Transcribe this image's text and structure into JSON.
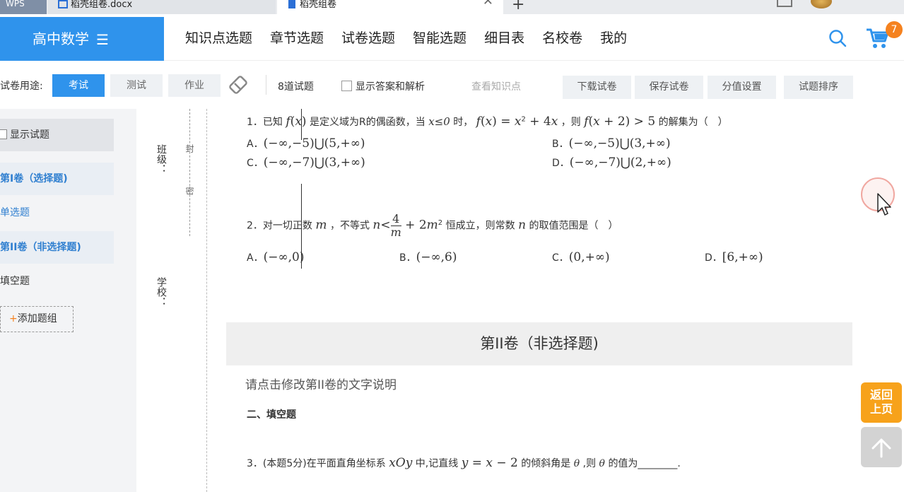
{
  "tabs": {
    "wps": "WPS",
    "docx": "稻壳组卷.docx",
    "active": "稻壳组卷",
    "close": "✕",
    "plus": "+"
  },
  "header": {
    "brand": "高中数学",
    "menu_icon": "☰",
    "nav": [
      "知识点选题",
      "章节选题",
      "试卷选题",
      "智能选题",
      "细目表",
      "名校卷",
      "我的"
    ],
    "cart_count": "7"
  },
  "toolbar": {
    "label": "试卷用途:",
    "purposes": [
      "考试",
      "测试",
      "作业"
    ],
    "question_count": "8道试题",
    "show_answer": "显示答案和解析",
    "view_knowledge": "查看知识点",
    "actions": [
      "下载试卷",
      "保存试卷",
      "分值设置",
      "试题排序"
    ]
  },
  "sidebar": {
    "show_questions": "显示试题",
    "items": [
      "第I卷（选择题)",
      "单选题",
      "第II卷（非选择题)",
      "填空题"
    ],
    "add_group_plus": "+",
    "add_group": "添加题组"
  },
  "binding": {
    "class": "班级：",
    "school": "学校：",
    "seal": "封",
    "secret": "密"
  },
  "questions": {
    "q1": {
      "num": "1．已知",
      "p1": "是定义域为R的偶函数，当",
      "cond": "x≤0",
      "p2": "时，",
      "p3": "，则",
      "p4": "的解集为（　）",
      "A": "A．",
      "A_val": "(−∞,−5)⋃(5,+∞)",
      "B": "B．",
      "B_val": "(−∞,−5)⋃(3,+∞)",
      "C": "C．",
      "C_val": "(−∞,−7)⋃(3,+∞)",
      "D": "D．",
      "D_val": "(−∞,−7)⋃(2,+∞)"
    },
    "q2": {
      "num": "2．对一切正数",
      "p1": "，不等式",
      "p2": "恒成立，则常数",
      "p3": "的取值范围是（　）",
      "A": "A．",
      "A_val": "(−∞,0)",
      "B": "B．",
      "B_val": "(−∞,6)",
      "C": "C．",
      "C_val": "(0,+∞)",
      "D": "D．",
      "D_val": "[6,+∞)"
    },
    "section2_title": "第II卷（非选择题)",
    "section2_desc": "请点击修改第II卷的文字说明",
    "section2_sub": "二、填空题",
    "q3": {
      "num": "3．(本题5分)在平面直角坐标系",
      "p1": "中,记直线",
      "p2": "的倾斜角是",
      "p3": ",则",
      "p4": "的值为________."
    }
  },
  "floating": {
    "back_line1": "返回",
    "back_line2": "上页"
  },
  "colors": {
    "brand_blue": "#2f93ec",
    "accent_orange": "#f5821f"
  }
}
